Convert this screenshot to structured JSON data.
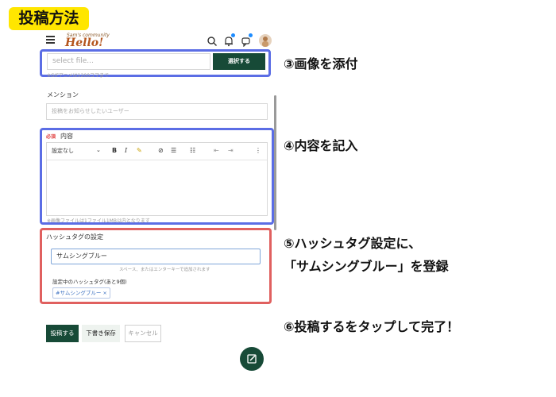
{
  "title_badge": "投稿方法",
  "header": {
    "logo_small": "Sam's community",
    "logo_big": "Hello!"
  },
  "file": {
    "placeholder": "select file...",
    "button": "選択する",
    "hint": "※GIFアニメは1200コマまで"
  },
  "mention": {
    "label": "メンション",
    "placeholder": "投稿をお知らせしたいユーザー"
  },
  "content": {
    "required": "必須",
    "label": "内容",
    "toolbar_format": "設定なし",
    "hint": "※画像ファイルは1ファイル1MB以内となります"
  },
  "hashtag": {
    "label": "ハッシュタグの設定",
    "value": "サムシングブルー",
    "hint": "スペース、またはエンターキーで追加されます",
    "current_label": "設定中のハッシュタグ(あと9個)",
    "chip": "#サムシングブルー ×"
  },
  "actions": {
    "post": "投稿する",
    "draft": "下書き保存",
    "cancel": "キャンセル"
  },
  "steps": {
    "s3": "③画像を添付",
    "s4": "④内容を記入",
    "s5_line1": "⑤ハッシュタグ設定に、",
    "s5_line2": "「サムシングブルー」を登録",
    "s6": "⑥投稿するをタップして完了！"
  },
  "colors": {
    "badge": "#ffe600",
    "primary": "#174a37",
    "frame_blue": "#5b6de5",
    "frame_red": "#e0605f"
  }
}
